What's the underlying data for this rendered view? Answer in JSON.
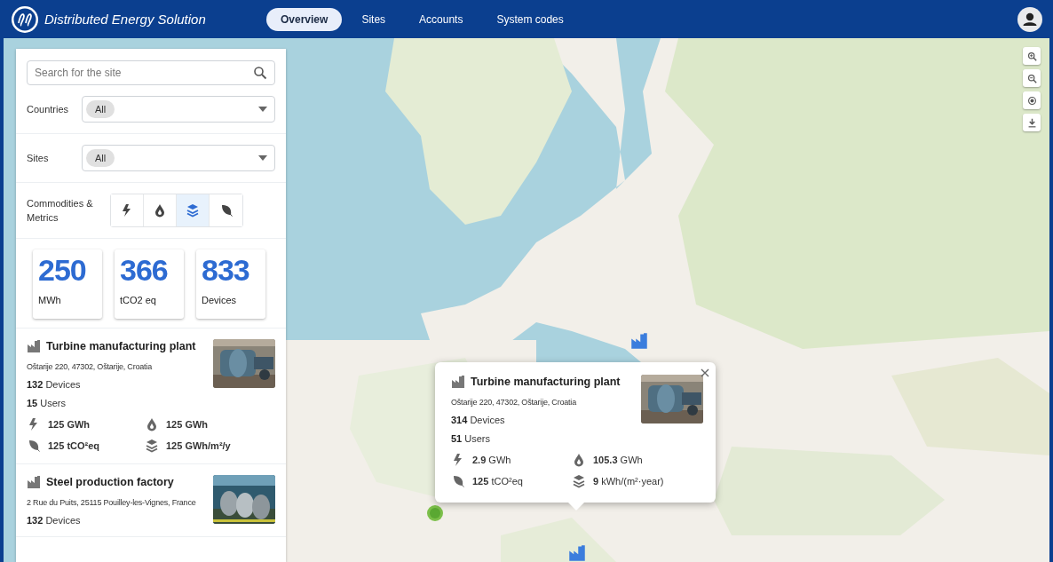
{
  "header": {
    "title": "Distributed Energy Solution",
    "nav": [
      {
        "label": "Overview",
        "selected": true
      },
      {
        "label": "Sites",
        "selected": false
      },
      {
        "label": "Accounts",
        "selected": false
      },
      {
        "label": "System codes",
        "selected": false
      }
    ]
  },
  "filters": {
    "search": {
      "placeholder": "Search for the site"
    },
    "selects": [
      {
        "label": "Countries",
        "value": "All"
      },
      {
        "label": "Sites",
        "value": "All"
      }
    ]
  },
  "commodities": {
    "label": "Commodities & Metrics",
    "options": [
      {
        "kind": "electricity",
        "selected": false
      },
      {
        "kind": "water",
        "selected": false
      },
      {
        "kind": "intensity",
        "selected": true
      },
      {
        "kind": "carbon",
        "selected": false
      }
    ]
  },
  "totals": [
    {
      "value": "250",
      "unit": "MWh"
    },
    {
      "value": "366",
      "unit": "tCO2 eq"
    },
    {
      "value": "833",
      "unit": "Devices"
    }
  ],
  "sites": [
    {
      "name": "Turbine manufacturing plant",
      "address": "Oštarije 220, 47302, Oštarije, Croatia",
      "devices": "**132** Devices",
      "users": "**15** Users",
      "metrics": [
        {
          "kind": "electricity",
          "text": "125 GWh"
        },
        {
          "kind": "water",
          "text": "125 GWh"
        },
        {
          "kind": "carbon",
          "text": "125 tCO²eq"
        },
        {
          "kind": "intensity",
          "text": "125 GWh/m²/y"
        }
      ]
    },
    {
      "name": "Steel production factory",
      "address": "2 Rue du Puits, 25115 Pouilley-les-Vignes, France",
      "devices": "**132** Devices"
    }
  ],
  "popup": {
    "name": "Turbine manufacturing plant",
    "address": "Oštarije 220, 47302, Oštarije, Croatia",
    "devices": "**314** Devices",
    "users": "**51** Users",
    "metrics": [
      {
        "kind": "electricity",
        "text": "**2.9** GWh"
      },
      {
        "kind": "water",
        "text": "**105.3** GWh"
      },
      {
        "kind": "carbon",
        "text": "**125** tCO²eq"
      },
      {
        "kind": "intensity",
        "text": "**9** kWh/(m²·year)"
      }
    ]
  },
  "map_markers": [
    {
      "kind": "factory"
    },
    {
      "kind": "factory"
    },
    {
      "kind": "cluster"
    }
  ],
  "map_controls": [
    {
      "kind": "zoom_in"
    },
    {
      "kind": "zoom_out"
    },
    {
      "kind": "locate"
    },
    {
      "kind": "download"
    }
  ]
}
